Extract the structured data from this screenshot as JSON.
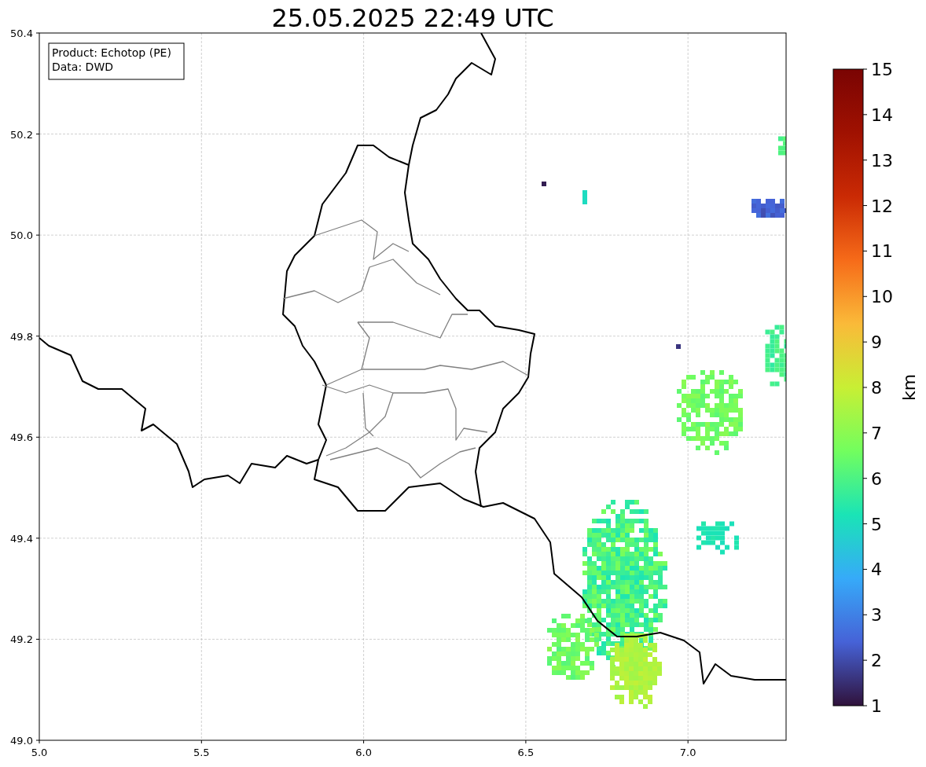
{
  "title": "25.05.2025 22:49 UTC",
  "map": {
    "info_lines": [
      "Product: Echotop (PE)",
      "Data: DWD"
    ],
    "x_ticks": [
      "5.0",
      "5.5",
      "6.0",
      "6.5",
      "7.0"
    ],
    "y_ticks": [
      "50.4",
      "50.2",
      "50.0",
      "49.8",
      "49.6",
      "49.4",
      "49.2",
      "49.0"
    ]
  },
  "colorbar": {
    "label": "km",
    "ticks": [
      "15",
      "14",
      "13",
      "12",
      "11",
      "10",
      "9",
      "8",
      "7",
      "6",
      "5",
      "4",
      "3",
      "2",
      "1"
    ]
  }
}
